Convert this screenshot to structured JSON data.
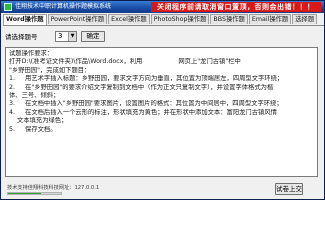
{
  "window": {
    "title": "佳翔技术中职计算机操作题模拟系统",
    "banner": "关闭程序前请取消窗口置顶，否则会出错！！！"
  },
  "tabs": [
    {
      "label": "Word操作题",
      "active": true
    },
    {
      "label": "PowerPoint操作题",
      "active": false
    },
    {
      "label": "Excel操作题",
      "active": false
    },
    {
      "label": "PhotoShop操作题",
      "active": false
    },
    {
      "label": "BBS操作题",
      "active": false
    },
    {
      "label": "Email操作题",
      "active": false
    },
    {
      "label": "选择题",
      "active": false
    }
  ],
  "question_selector": {
    "label": "请选择题号",
    "selected": "3",
    "confirm_label": "确定"
  },
  "content": {
    "lines": [
      "试题操作要求：",
      "打开D:\\(准考证文件夹)\\作品\\Word.docx，利用                  网页上\"龙门古镇\"栏中",
      "\"乡野田园\"，完成如下题目：",
      "1.     用艺术字插入标题：乡野田园，要求文字方向为垂直，其位置为顶端居左，四周型文字环绕；",
      "2.     在\"乡野田园\"的要求介绍文字复制到文档中（作为正文只复制文字），并设置字体格式为楷",
      "体、三号、倾斜；",
      "3.     在文档中插入\"乡野田园\"要求图片，设置图片的格式：其位置为中间居中，四周型文字环绕；",
      "4.     在文档后插入一个云形的标注，形状填充为黄色；并在形状中添加文本：富阳龙门古镇风情",
      "    文本填充为绿色；",
      "5.     保存文档。"
    ]
  },
  "status": {
    "text": "技术支持佳翔科技科技网址：127.0.0.1",
    "progress": 0.62,
    "submit_label": "试卷上交"
  }
}
